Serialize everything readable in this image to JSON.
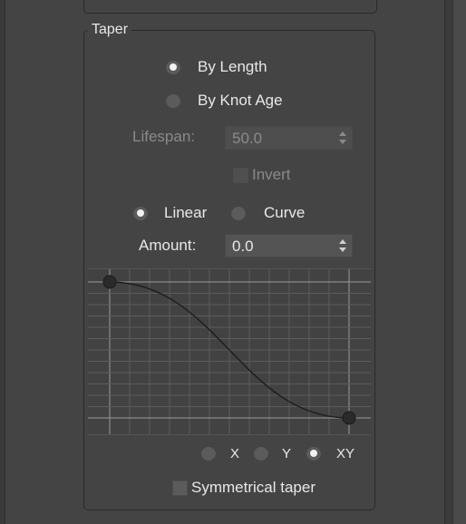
{
  "taper": {
    "title": "Taper",
    "mode_options": [
      {
        "label": "By Length",
        "selected": true
      },
      {
        "label": "By Knot Age",
        "selected": false
      }
    ],
    "lifespan": {
      "label": "Lifespan:",
      "value": "50.0",
      "enabled": false
    },
    "invert": {
      "label": "Invert",
      "checked": false,
      "enabled": false
    },
    "shape_options": [
      {
        "label": "Linear",
        "selected": true
      },
      {
        "label": "Curve",
        "selected": false
      }
    ],
    "amount": {
      "label": "Amount:",
      "value": "0.0"
    },
    "axis_options": [
      {
        "label": "X",
        "selected": false
      },
      {
        "label": "Y",
        "selected": false
      },
      {
        "label": "XY",
        "selected": true
      }
    ],
    "symmetrical": {
      "label": "Symmetrical taper",
      "checked": false
    }
  },
  "curve_graph": {
    "start_value": 1.0,
    "end_value": 0.0,
    "grid_columns": 12,
    "grid_rows": 12
  },
  "colors": {
    "panel_bg": "#444444",
    "border": "#2a2a2a",
    "text": "#e8e8e8",
    "disabled_text": "#8a8a8a"
  }
}
